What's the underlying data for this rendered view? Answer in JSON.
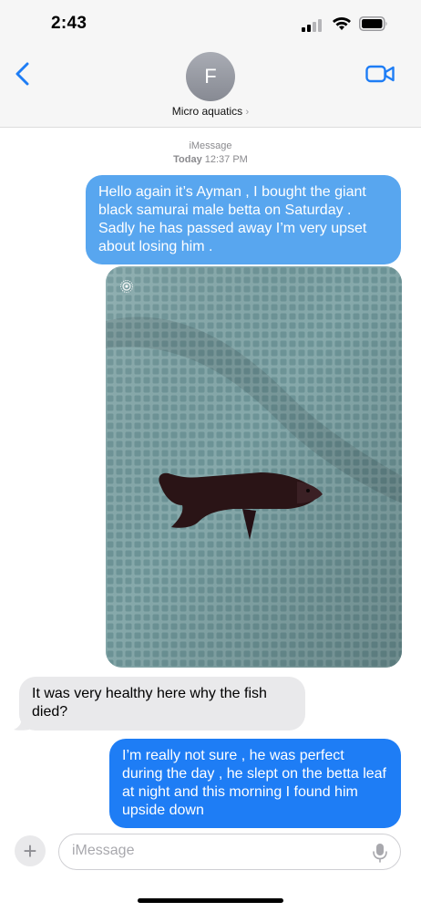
{
  "status_bar": {
    "time": "2:43"
  },
  "header": {
    "avatar_initial": "F",
    "contact_name": "Micro aquatics",
    "chevron": "›"
  },
  "thread": {
    "service": "iMessage",
    "day": "Today",
    "time": "12:37 PM",
    "messages": [
      {
        "direction": "outgoing",
        "text": "Hello again it’s Ayman , I bought the giant black samurai male betta on Saturday . Sadly he has passed away I’m very upset about losing him ."
      },
      {
        "direction": "outgoing",
        "type": "photo"
      },
      {
        "direction": "incoming",
        "text": "It was very healthy here why the fish died?"
      },
      {
        "direction": "outgoing",
        "text": "I’m really not sure , he was perfect during the day , he slept on the betta leaf at night and this morning I found him upside down"
      }
    ]
  },
  "composer": {
    "plus_label": "+",
    "placeholder": "iMessage"
  },
  "icons": {
    "back": "chevron-left-icon",
    "video": "video-camera-icon",
    "mic": "microphone-icon",
    "signal": "cellular-signal-icon",
    "wifi": "wifi-icon",
    "battery": "battery-icon",
    "live": "live-photo-icon"
  },
  "colors": {
    "accent": "#1e7df5",
    "outgoing_bubble": "#58a6ef",
    "incoming_bubble": "#e9e9eb",
    "photo_towel": "#7a9ea1",
    "fish": "#2a1416"
  }
}
